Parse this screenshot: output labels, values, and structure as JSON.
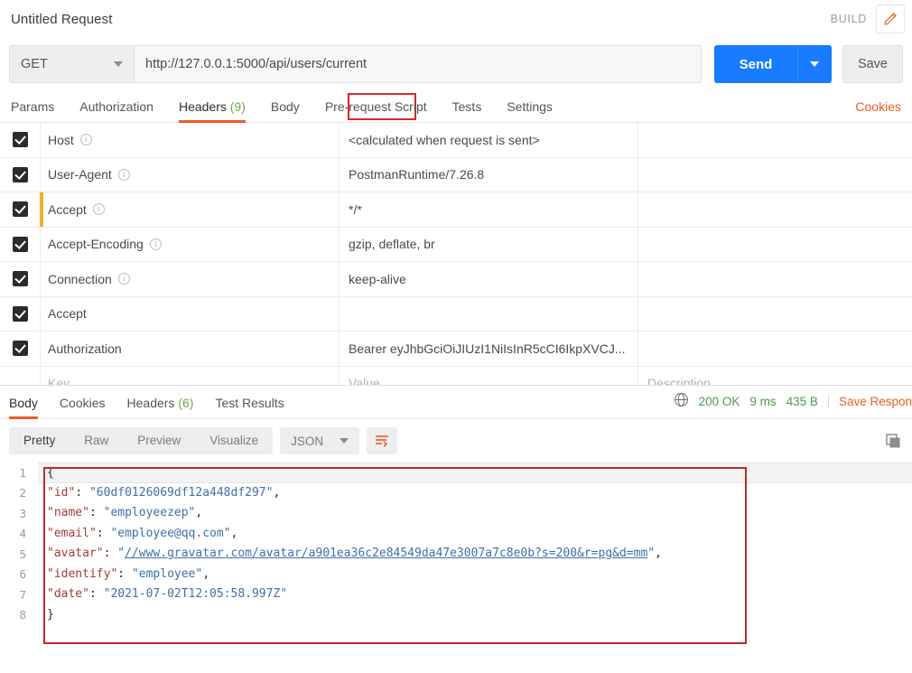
{
  "titlebar": {
    "request_title": "Untitled Request",
    "build_label": "BUILD",
    "pencil_icon": "pencil-icon"
  },
  "urlbar": {
    "method": "GET",
    "url": "http://127.0.0.1:5000/api/users/current",
    "send_label": "Send",
    "save_label": "Save",
    "annotation_target": "current",
    "annotation_color": "#d42a2a"
  },
  "request_tabs": {
    "items": [
      {
        "label": "Params",
        "count": "",
        "active": false
      },
      {
        "label": "Authorization",
        "count": "",
        "active": false
      },
      {
        "label": "Headers",
        "count": "(9)",
        "active": true
      },
      {
        "label": "Body",
        "count": "",
        "active": false
      },
      {
        "label": "Pre-request Script",
        "count": "",
        "active": false
      },
      {
        "label": "Tests",
        "count": "",
        "active": false
      },
      {
        "label": "Settings",
        "count": "",
        "active": false
      }
    ],
    "cookies_label": "Cookies",
    "accent_color": "#ef5b25"
  },
  "headers_table": {
    "columns": {
      "key": "Key",
      "value": "Value",
      "description": "Description"
    },
    "rows": [
      {
        "checked": true,
        "key": "Host",
        "info": true,
        "value": "<calculated when request is sent>",
        "description": "",
        "marked": false
      },
      {
        "checked": true,
        "key": "User-Agent",
        "info": true,
        "value": "PostmanRuntime/7.26.8",
        "description": "",
        "marked": false
      },
      {
        "checked": true,
        "key": "Accept",
        "info": true,
        "value": "*/*",
        "description": "",
        "marked": true
      },
      {
        "checked": true,
        "key": "Accept-Encoding",
        "info": true,
        "value": "gzip, deflate, br",
        "description": "",
        "marked": false
      },
      {
        "checked": true,
        "key": "Connection",
        "info": true,
        "value": "keep-alive",
        "description": "",
        "marked": false
      },
      {
        "checked": true,
        "key": "Accept",
        "info": false,
        "value": "",
        "description": "",
        "marked": false
      },
      {
        "checked": true,
        "key": "Authorization",
        "info": false,
        "value": "Bearer eyJhbGciOiJIUzI1NiIsInR5cCI6IkpXVCJ...",
        "description": "",
        "marked": false
      }
    ]
  },
  "response": {
    "tabs": [
      {
        "label": "Body",
        "count": "",
        "active": true
      },
      {
        "label": "Cookies",
        "count": "",
        "active": false
      },
      {
        "label": "Headers",
        "count": "(6)",
        "active": false
      },
      {
        "label": "Test Results",
        "count": "",
        "active": false
      }
    ],
    "globe_icon": "globe-icon",
    "status": "200 OK",
    "time": "9 ms",
    "size": "435 B",
    "save_response_label": "Save Respon",
    "status_color": "#4a9c4a",
    "copy_icon": "copy-icon"
  },
  "view_toolbar": {
    "segments": [
      {
        "label": "Pretty",
        "active": true
      },
      {
        "label": "Raw",
        "active": false
      },
      {
        "label": "Preview",
        "active": false
      },
      {
        "label": "Visualize",
        "active": false
      }
    ],
    "format": "JSON",
    "wrap_icon": "word-wrap-icon"
  },
  "code": {
    "annotation_color": "#c22a2a",
    "lines": [
      {
        "num": "1",
        "highlight": true,
        "tokens": [
          {
            "t": "p",
            "v": "{"
          }
        ]
      },
      {
        "num": "2",
        "highlight": false,
        "tokens": [
          {
            "t": "p",
            "v": "    "
          },
          {
            "t": "k",
            "v": "\"id\""
          },
          {
            "t": "p",
            "v": ": "
          },
          {
            "t": "s",
            "v": "\"60df0126069df12a448df297\""
          },
          {
            "t": "p",
            "v": ","
          }
        ]
      },
      {
        "num": "3",
        "highlight": false,
        "tokens": [
          {
            "t": "p",
            "v": "    "
          },
          {
            "t": "k",
            "v": "\"name\""
          },
          {
            "t": "p",
            "v": ": "
          },
          {
            "t": "s",
            "v": "\"employeezep\""
          },
          {
            "t": "p",
            "v": ","
          }
        ]
      },
      {
        "num": "4",
        "highlight": false,
        "tokens": [
          {
            "t": "p",
            "v": "    "
          },
          {
            "t": "k",
            "v": "\"email\""
          },
          {
            "t": "p",
            "v": ": "
          },
          {
            "t": "s",
            "v": "\"employee@qq.com\""
          },
          {
            "t": "p",
            "v": ","
          }
        ]
      },
      {
        "num": "5",
        "highlight": false,
        "tokens": [
          {
            "t": "p",
            "v": "    "
          },
          {
            "t": "k",
            "v": "\"avatar\""
          },
          {
            "t": "p",
            "v": ": "
          },
          {
            "t": "s",
            "v": "\""
          },
          {
            "t": "lnk",
            "v": "//www.gravatar.com/avatar/a901ea36c2e84549da47e3007a7c8e0b?s=200&r=pg&d=mm"
          },
          {
            "t": "s",
            "v": "\""
          },
          {
            "t": "p",
            "v": ","
          }
        ]
      },
      {
        "num": "6",
        "highlight": false,
        "tokens": [
          {
            "t": "p",
            "v": "    "
          },
          {
            "t": "k",
            "v": "\"identify\""
          },
          {
            "t": "p",
            "v": ": "
          },
          {
            "t": "s",
            "v": "\"employee\""
          },
          {
            "t": "p",
            "v": ","
          }
        ]
      },
      {
        "num": "7",
        "highlight": false,
        "tokens": [
          {
            "t": "p",
            "v": "    "
          },
          {
            "t": "k",
            "v": "\"date\""
          },
          {
            "t": "p",
            "v": ": "
          },
          {
            "t": "s",
            "v": "\"2021-07-02T12:05:58.997Z\""
          }
        ]
      },
      {
        "num": "8",
        "highlight": false,
        "tokens": [
          {
            "t": "p",
            "v": "}"
          }
        ]
      }
    ]
  }
}
